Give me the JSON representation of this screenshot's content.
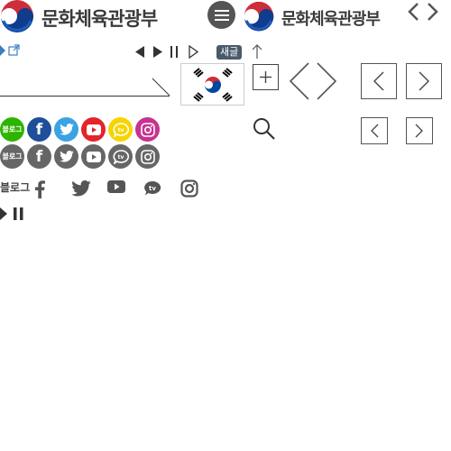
{
  "header": {
    "ministry_name": "문화체육관광부",
    "ministry_name_alt": "문화체육관광부",
    "menu_icon": "hamburger-icon",
    "nav_arrows": "code-arrows-icon"
  },
  "controls": {
    "new_badge": "새글",
    "blog_label": "블로그"
  },
  "sns_colored": [
    {
      "id": "blog",
      "label": "블로그",
      "color": "#2db400"
    },
    {
      "id": "facebook",
      "label": "f",
      "color": "#1f4f9b"
    },
    {
      "id": "twitter",
      "label": "twitter",
      "color": "#3aa3e3"
    },
    {
      "id": "youtube",
      "label": "youtube",
      "color": "#e4232a"
    },
    {
      "id": "kakaotv",
      "label": "tv",
      "color": "#f5d400"
    },
    {
      "id": "instagram",
      "label": "instagram",
      "color": "#c8338f"
    }
  ],
  "sns_gray": [
    {
      "id": "blog",
      "label": "블로그",
      "color": "#666666"
    },
    {
      "id": "facebook",
      "label": "f",
      "color": "#666666"
    },
    {
      "id": "twitter",
      "label": "twitter",
      "color": "#666666"
    },
    {
      "id": "youtube",
      "label": "youtube",
      "color": "#666666"
    },
    {
      "id": "kakaotv",
      "label": "tv",
      "color": "#666666"
    },
    {
      "id": "instagram",
      "label": "instagram",
      "color": "#666666"
    }
  ],
  "sns_plain": {
    "blog_label": "블로그"
  }
}
